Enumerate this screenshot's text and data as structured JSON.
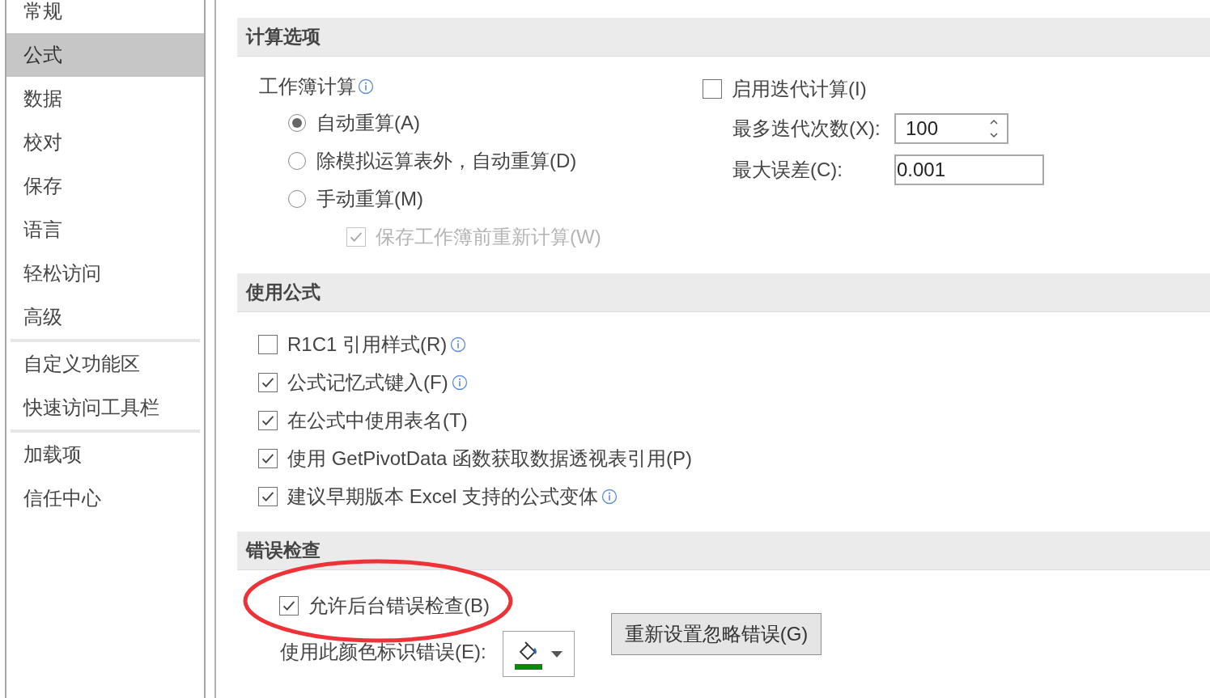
{
  "sidebar": {
    "groups": [
      [
        {
          "label": "常规",
          "selected": false
        },
        {
          "label": "公式",
          "selected": true
        },
        {
          "label": "数据",
          "selected": false
        },
        {
          "label": "校对",
          "selected": false
        },
        {
          "label": "保存",
          "selected": false
        },
        {
          "label": "语言",
          "selected": false
        },
        {
          "label": "轻松访问",
          "selected": false
        },
        {
          "label": "高级",
          "selected": false
        }
      ],
      [
        {
          "label": "自定义功能区",
          "selected": false
        },
        {
          "label": "快速访问工具栏",
          "selected": false
        }
      ],
      [
        {
          "label": "加载项",
          "selected": false
        },
        {
          "label": "信任中心",
          "selected": false
        }
      ]
    ]
  },
  "calculation": {
    "title": "计算选项",
    "workbook_calc": {
      "label": "工作簿计算",
      "info": true
    },
    "modes": [
      {
        "label": "自动重算(A)",
        "selected": true
      },
      {
        "label": "除模拟运算表外，自动重算(D)",
        "selected": false
      },
      {
        "label": "手动重算(M)",
        "selected": false
      }
    ],
    "recalc_before_save": {
      "label": "保存工作簿前重新计算(W)",
      "checked": true,
      "disabled": true
    },
    "iteration": {
      "label": "启用迭代计算(I)",
      "checked": false
    },
    "max_iterations": {
      "label": "最多迭代次数(X):",
      "value": "100"
    },
    "max_change": {
      "label": "最大误差(C):",
      "value": "0.001"
    }
  },
  "formulas": {
    "title": "使用公式",
    "options": [
      {
        "label": "R1C1 引用样式(R)",
        "checked": false,
        "info": true
      },
      {
        "label": "公式记忆式键入(F)",
        "checked": true,
        "info": true
      },
      {
        "label": "在公式中使用表名(T)",
        "checked": true,
        "info": false
      },
      {
        "label": "使用 GetPivotData 函数获取数据透视表引用(P)",
        "checked": true,
        "info": false
      },
      {
        "label": "建议早期版本 Excel 支持的公式变体",
        "checked": true,
        "info": true
      }
    ]
  },
  "error_checking": {
    "title": "错误检查",
    "background_checking": {
      "label": "允许后台错误检查(B)",
      "checked": true
    },
    "color_label": "使用此颜色标识错误(E):",
    "reset_button": "重新设置忽略错误(G)"
  },
  "annotation": {
    "kind": "ellipse"
  }
}
